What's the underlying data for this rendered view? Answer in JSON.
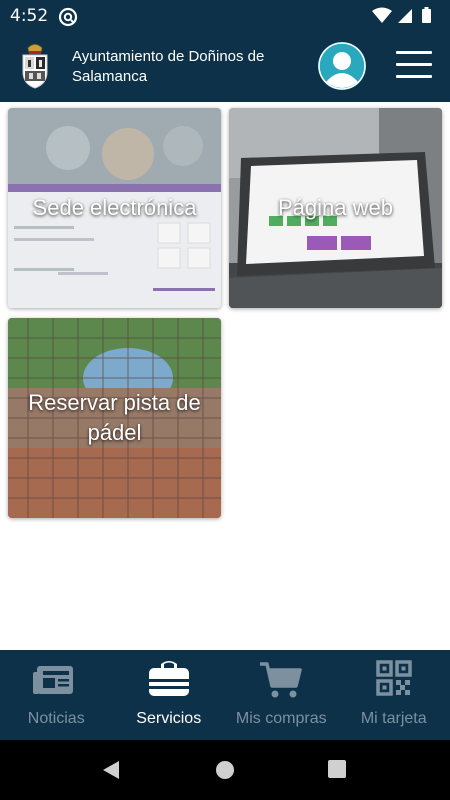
{
  "status_bar": {
    "time": "4:52",
    "app_icon": "at-sign-icon",
    "icons": [
      "wifi-icon",
      "signal-icon",
      "battery-icon"
    ]
  },
  "header": {
    "title": "Ayuntamiento de Doñinos de Salamanca",
    "crest_icon": "coat-of-arms-icon",
    "avatar_icon": "user-avatar-icon",
    "menu_icon": "hamburger-menu-icon",
    "color": "#0d3148",
    "avatar_color": "#2aa8be"
  },
  "tiles": [
    {
      "label": "Sede electrónica",
      "icon": "sede-electronica-image"
    },
    {
      "label": "Página web",
      "icon": "laptop-website-image"
    },
    {
      "label": "Reservar pista de pádel",
      "icon": "padel-court-image"
    }
  ],
  "bottom_nav": {
    "items": [
      {
        "label": "Noticias",
        "icon": "newspaper-icon",
        "active": false
      },
      {
        "label": "Servicios",
        "icon": "briefcase-icon",
        "active": true
      },
      {
        "label": "Mis compras",
        "icon": "shopping-cart-icon",
        "active": false
      },
      {
        "label": "Mi tarjeta",
        "icon": "qr-code-icon",
        "active": false
      }
    ],
    "active_color": "#ffffff",
    "inactive_color": "#7c90a0"
  },
  "system_nav": {
    "icons": [
      "back-icon",
      "home-icon",
      "recents-icon"
    ]
  }
}
